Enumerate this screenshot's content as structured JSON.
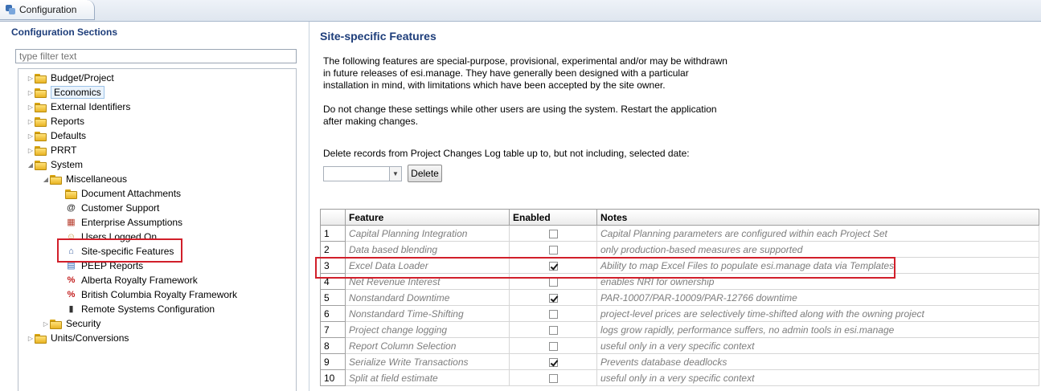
{
  "window": {
    "tab_title": "Configuration"
  },
  "left": {
    "title": "Configuration Sections",
    "filter_placeholder": "type filter text",
    "tree": [
      {
        "label": "Budget/Project",
        "level": 0,
        "arrow": "▷",
        "icon": "folder"
      },
      {
        "label": "Economics",
        "level": 0,
        "arrow": "▷",
        "icon": "folder",
        "selected": true
      },
      {
        "label": "External Identifiers",
        "level": 0,
        "arrow": "▷",
        "icon": "folder"
      },
      {
        "label": "Reports",
        "level": 0,
        "arrow": "▷",
        "icon": "folder"
      },
      {
        "label": "Defaults",
        "level": 0,
        "arrow": "▷",
        "icon": "folder"
      },
      {
        "label": "PRRT",
        "level": 0,
        "arrow": "▷",
        "icon": "folder"
      },
      {
        "label": "System",
        "level": 0,
        "arrow": "◢",
        "icon": "folder"
      },
      {
        "label": "Miscellaneous",
        "level": 1,
        "arrow": "◢",
        "icon": "folder"
      },
      {
        "label": "Document Attachments",
        "level": 2,
        "arrow": "",
        "icon": "folder"
      },
      {
        "label": "Customer Support",
        "level": 2,
        "arrow": "",
        "icon": "at"
      },
      {
        "label": "Enterprise Assumptions",
        "level": 2,
        "arrow": "",
        "icon": "calc"
      },
      {
        "label": "Users Logged On",
        "level": 2,
        "arrow": "",
        "icon": "user"
      },
      {
        "label": "Site-specific Features",
        "level": 2,
        "arrow": "",
        "icon": "ghost"
      },
      {
        "label": "PEEP Reports",
        "level": 2,
        "arrow": "",
        "icon": "report"
      },
      {
        "label": "Alberta Royalty Framework",
        "level": 2,
        "arrow": "",
        "icon": "percent"
      },
      {
        "label": "British Columbia Royalty Framework",
        "level": 2,
        "arrow": "",
        "icon": "percent"
      },
      {
        "label": "Remote Systems Configuration",
        "level": 2,
        "arrow": "",
        "icon": "server"
      },
      {
        "label": "Security",
        "level": 1,
        "arrow": "▷",
        "icon": "folder"
      },
      {
        "label": "Units/Conversions",
        "level": 0,
        "arrow": "▷",
        "icon": "folder"
      }
    ]
  },
  "main": {
    "title": "Site-specific Features",
    "desc1": [
      "The following features are special-purpose, provisional, experimental and/or may be withdrawn",
      "in future releases of esi.manage.  They have generally been designed with a particular",
      "installation in mind, with limitations which have been accepted by the site owner."
    ],
    "desc2": [
      "Do not change these settings while other users are using the system.  Restart the application",
      "after making changes."
    ],
    "delete_prompt": "Delete records from Project Changes Log table up to, but not including, selected date:",
    "delete_label": "Delete",
    "date_value": "",
    "columns": [
      "Feature",
      "Enabled",
      "Notes"
    ],
    "rows": [
      {
        "n": "1",
        "feature": "Capital Planning Integration",
        "enabled": false,
        "notes": "Capital Planning parameters are configured within each Project Set"
      },
      {
        "n": "2",
        "feature": "Data based blending",
        "enabled": false,
        "notes": "only production-based measures are supported"
      },
      {
        "n": "3",
        "feature": "Excel Data Loader",
        "enabled": true,
        "notes": "Ability to map Excel Files to populate esi.manage data via Templates"
      },
      {
        "n": "4",
        "feature": "Net Revenue Interest",
        "enabled": false,
        "notes": "enables NRI for ownership"
      },
      {
        "n": "5",
        "feature": "Nonstandard Downtime",
        "enabled": true,
        "notes": "PAR-10007/PAR-10009/PAR-12766 downtime"
      },
      {
        "n": "6",
        "feature": "Nonstandard Time-Shifting",
        "enabled": false,
        "notes": "project-level prices are selectively time-shifted along with the owning project"
      },
      {
        "n": "7",
        "feature": "Project change logging",
        "enabled": false,
        "notes": "logs grow rapidly, performance suffers, no admin tools in esi.manage"
      },
      {
        "n": "8",
        "feature": "Report Column Selection",
        "enabled": false,
        "notes": "useful only in a very specific context"
      },
      {
        "n": "9",
        "feature": "Serialize Write Transactions",
        "enabled": true,
        "notes": "Prevents database deadlocks"
      },
      {
        "n": "10",
        "feature": "Split at field estimate",
        "enabled": false,
        "notes": "useful only in a very specific context"
      }
    ]
  }
}
